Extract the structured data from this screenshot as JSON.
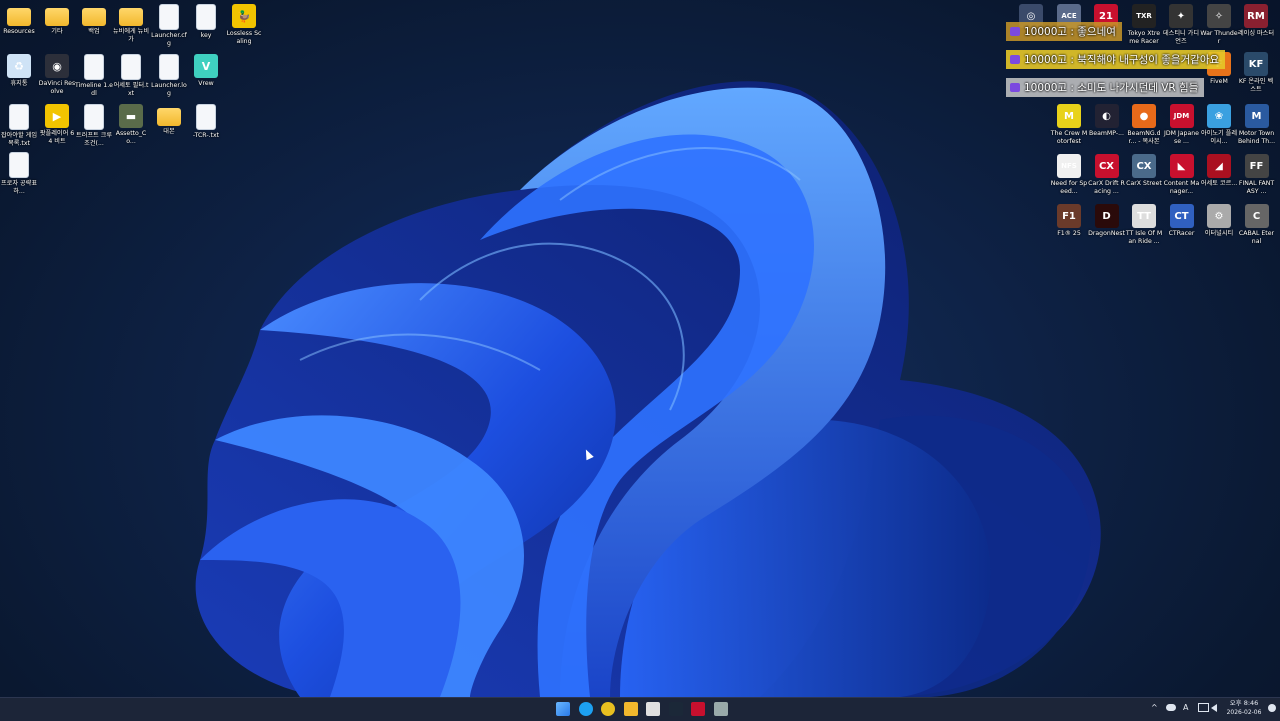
{
  "desktop_left": [
    {
      "label": "Resources",
      "kind": "folder"
    },
    {
      "label": "기타",
      "kind": "folder"
    },
    {
      "label": "백업",
      "kind": "folder"
    },
    {
      "label": "뉴비에게 뉴비가",
      "kind": "folder"
    },
    {
      "label": "Launcher.cfg",
      "kind": "doc"
    },
    {
      "label": "key",
      "kind": "doc"
    },
    {
      "label": "Lossless Scaling",
      "kind": "app",
      "color": "#f2c400",
      "text": "🦆"
    },
    {
      "label": "휴지통",
      "kind": "app",
      "color": "#cfe3f6",
      "text": "♻"
    },
    {
      "label": "DaVinci Resolve",
      "kind": "app",
      "color": "#2c2f3a",
      "text": "◉"
    },
    {
      "label": "Timeline 1.edl",
      "kind": "doc"
    },
    {
      "label": "어세토 필터.txt",
      "kind": "doc"
    },
    {
      "label": "Launcher.log",
      "kind": "doc"
    },
    {
      "label": "Vrew",
      "kind": "app",
      "color": "#3fd0c0",
      "text": "V"
    },
    {
      "label": "잡아야할 게임 목록.txt",
      "kind": "doc"
    },
    {
      "label": "팟플레이어 64 비트",
      "kind": "app",
      "color": "#f2c400",
      "text": "▶"
    },
    {
      "label": "트러프트 크루 조건(...",
      "kind": "doc"
    },
    {
      "label": "Assetto_Co...",
      "kind": "app",
      "color": "#5a6b4a",
      "text": "▬"
    },
    {
      "label": "대본",
      "kind": "folder"
    },
    {
      "label": "-TCR-.txt",
      "kind": "doc"
    },
    {
      "label": "프로자 공략표 하...",
      "kind": "doc"
    }
  ],
  "desktop_right": [
    {
      "label": "",
      "color": "#3a4a6a",
      "text": "◎"
    },
    {
      "label": "",
      "color": "#5a6a8a",
      "text": "ACE"
    },
    {
      "label": "",
      "color": "#c8102e",
      "text": "21"
    },
    {
      "label": "Tokyo Xtreme Racer",
      "color": "#222",
      "text": "TXR"
    },
    {
      "label": "데스티니 가디언즈",
      "color": "#333",
      "text": "✦"
    },
    {
      "label": "War Thunder",
      "color": "#444",
      "text": "✧"
    },
    {
      "label": "레이싱 마스터",
      "color": "#8a2030",
      "text": "RM"
    },
    {
      "label": "",
      "color": "#333",
      "text": ""
    },
    {
      "label": "",
      "color": "#333",
      "text": ""
    },
    {
      "label": "",
      "color": "#333",
      "text": ""
    },
    {
      "label": "",
      "color": "#333",
      "text": ""
    },
    {
      "label": "",
      "color": "#333",
      "text": ""
    },
    {
      "label": "FiveM",
      "color": "#e8731a",
      "text": "F"
    },
    {
      "label": "KF 온라인 벡스트",
      "color": "#2a4a6a",
      "text": "KF"
    },
    {
      "label": "The Crew Motorfest",
      "color": "#e8d21a",
      "text": "M"
    },
    {
      "label": "BeamMP-...",
      "color": "#223",
      "text": "◐"
    },
    {
      "label": "BeamNG.dr... - 복사본",
      "color": "#e86a1a",
      "text": "●"
    },
    {
      "label": "JDM Japanese ...",
      "color": "#c8102e",
      "text": "JDM"
    },
    {
      "label": "아이노기 플레이시...",
      "color": "#3aa0e0",
      "text": "❀"
    },
    {
      "label": "Motor Town Behind Th...",
      "color": "#2a5aa0",
      "text": "M"
    },
    {
      "label": "Need for Speed...",
      "color": "#f0f0f0",
      "text": "NFS"
    },
    {
      "label": "CarX Drift Racing ...",
      "color": "#c8102e",
      "text": "CX"
    },
    {
      "label": "CarX Street",
      "color": "#4a6a8a",
      "text": "CX"
    },
    {
      "label": "Content Manager...",
      "color": "#c8102e",
      "text": "◣"
    },
    {
      "label": "어세토 코르...",
      "color": "#aa1020",
      "text": "◢"
    },
    {
      "label": "FINAL FANTASY ...",
      "color": "#444",
      "text": "FF"
    },
    {
      "label": "F1® 25",
      "color": "#6a3a2a",
      "text": "F1"
    },
    {
      "label": "DragonNest",
      "color": "#2a0a0a",
      "text": "D"
    },
    {
      "label": "TT Isle Of Man Ride ...",
      "color": "#ddd",
      "text": "TT"
    },
    {
      "label": "CTRacer",
      "color": "#3060c0",
      "text": "CT"
    },
    {
      "label": "이터널시티",
      "color": "#aaa",
      "text": "⚙"
    },
    {
      "label": "CABAL Eternal",
      "color": "#666",
      "text": "C"
    }
  ],
  "chat_messages": [
    {
      "text": "10000고 : 좋으네여",
      "bg": "rgba(200,150,40,0.85)"
    },
    {
      "text": "10000고 : 북직해야 내구성이 좋을거같아요",
      "bg": "rgba(230,200,40,0.9)"
    },
    {
      "text": "10000고 : 소미도 나가시던데 VR 힘들",
      "bg": "rgba(200,200,200,0.85)"
    }
  ],
  "taskbar": {
    "icons": [
      {
        "name": "start-button",
        "color": "#4aa3ff"
      },
      {
        "name": "edge-icon",
        "color": "#1da1f2"
      },
      {
        "name": "chrome-icon",
        "color": "#e8c020"
      },
      {
        "name": "file-explorer-icon",
        "color": "#f2b82d"
      },
      {
        "name": "store-icon",
        "color": "#e0e0e0"
      },
      {
        "name": "steam-icon",
        "color": "#1b2838"
      },
      {
        "name": "app-red-icon",
        "color": "#c8102e"
      },
      {
        "name": "app-gray-icon",
        "color": "#9aa"
      }
    ],
    "tray_chevron": "^",
    "tray_lang": "A",
    "time": "오후 8:46",
    "date": "2026-02-06"
  }
}
